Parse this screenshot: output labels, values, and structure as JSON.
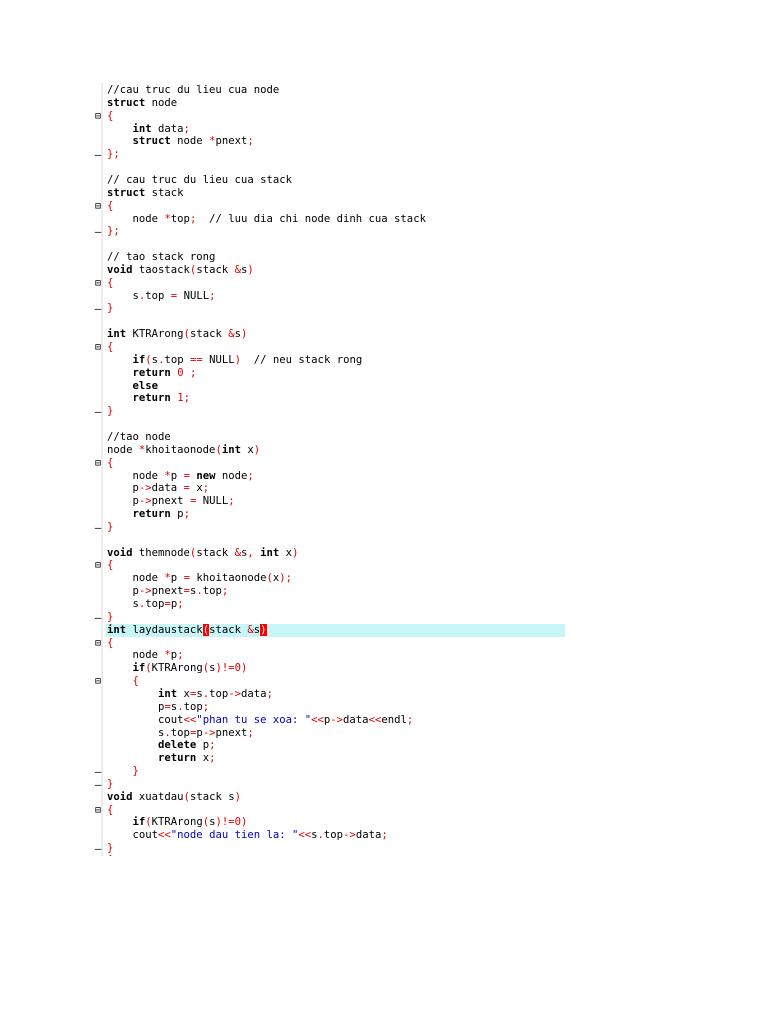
{
  "editor": {
    "lines": [
      {
        "text": "//cau truc du lieu cua node",
        "fold": ""
      },
      {
        "text": "struct node",
        "fold": ""
      },
      {
        "text": "{",
        "fold": "open"
      },
      {
        "text": "    int data;",
        "fold": ""
      },
      {
        "text": "    struct node *pnext;",
        "fold": ""
      },
      {
        "text": "};",
        "fold": "end"
      },
      {
        "text": "",
        "fold": ""
      },
      {
        "text": "// cau truc du lieu cua stack",
        "fold": ""
      },
      {
        "text": "struct stack",
        "fold": ""
      },
      {
        "text": "{",
        "fold": "open"
      },
      {
        "text": "    node *top;  // luu dia chi node dinh cua stack",
        "fold": ""
      },
      {
        "text": "};",
        "fold": "end"
      },
      {
        "text": "",
        "fold": ""
      },
      {
        "text": "// tao stack rong",
        "fold": ""
      },
      {
        "text": "void taostack(stack &s)",
        "fold": ""
      },
      {
        "text": "{",
        "fold": "open"
      },
      {
        "text": "    s.top = NULL;",
        "fold": ""
      },
      {
        "text": "}",
        "fold": "end"
      },
      {
        "text": "",
        "fold": ""
      },
      {
        "text": "int KTRArong(stack &s)",
        "fold": ""
      },
      {
        "text": "{",
        "fold": "open"
      },
      {
        "text": "    if(s.top == NULL)  // neu stack rong",
        "fold": ""
      },
      {
        "text": "    return 0 ;",
        "fold": ""
      },
      {
        "text": "    else",
        "fold": ""
      },
      {
        "text": "    return 1;",
        "fold": ""
      },
      {
        "text": "}",
        "fold": "end"
      },
      {
        "text": "",
        "fold": ""
      },
      {
        "text": "//tao node",
        "fold": ""
      },
      {
        "text": "node *khoitaonode(int x)",
        "fold": ""
      },
      {
        "text": "{",
        "fold": "open"
      },
      {
        "text": "    node *p = new node;",
        "fold": ""
      },
      {
        "text": "    p->data = x;",
        "fold": ""
      },
      {
        "text": "    p->pnext = NULL;",
        "fold": ""
      },
      {
        "text": "    return p;",
        "fold": ""
      },
      {
        "text": "}",
        "fold": "end"
      },
      {
        "text": "",
        "fold": ""
      },
      {
        "text": "void themnode(stack &s, int x)",
        "fold": ""
      },
      {
        "text": "{",
        "fold": "open"
      },
      {
        "text": "    node *p = khoitaonode(x);",
        "fold": ""
      },
      {
        "text": "    p->pnext=s.top;",
        "fold": ""
      },
      {
        "text": "    s.top=p;",
        "fold": ""
      },
      {
        "text": "}",
        "fold": "end"
      },
      {
        "text": "int laydaustack(stack &s)",
        "fold": "",
        "highlight": true
      },
      {
        "text": "{",
        "fold": "open"
      },
      {
        "text": "    node *p;",
        "fold": ""
      },
      {
        "text": "    if(KTRArong(s)!=0)",
        "fold": ""
      },
      {
        "text": "    {",
        "fold": "open"
      },
      {
        "text": "        int x=s.top->data;",
        "fold": ""
      },
      {
        "text": "        p=s.top;",
        "fold": ""
      },
      {
        "text": "        cout<<\"phan tu se xoa: \"<<p->data<<endl;",
        "fold": ""
      },
      {
        "text": "        s.top=p->pnext;",
        "fold": ""
      },
      {
        "text": "        delete p;",
        "fold": ""
      },
      {
        "text": "        return x;",
        "fold": ""
      },
      {
        "text": "    }",
        "fold": "end"
      },
      {
        "text": "}",
        "fold": "end"
      },
      {
        "text": "void xuatdau(stack s)",
        "fold": ""
      },
      {
        "text": "{",
        "fold": "open"
      },
      {
        "text": "    if(KTRArong(s)!=0)",
        "fold": ""
      },
      {
        "text": "    cout<<\"node dau tien la: \"<<s.top->data;",
        "fold": ""
      },
      {
        "text": "}",
        "fold": "end"
      },
      {
        "text": "int main()",
        "fold": ""
      }
    ]
  },
  "colors": {
    "keyword": "#000000",
    "operator": "#e00000",
    "string": "#0000c0",
    "highlight_line": "#c8f5f5",
    "brace_match": "#ff0000"
  }
}
